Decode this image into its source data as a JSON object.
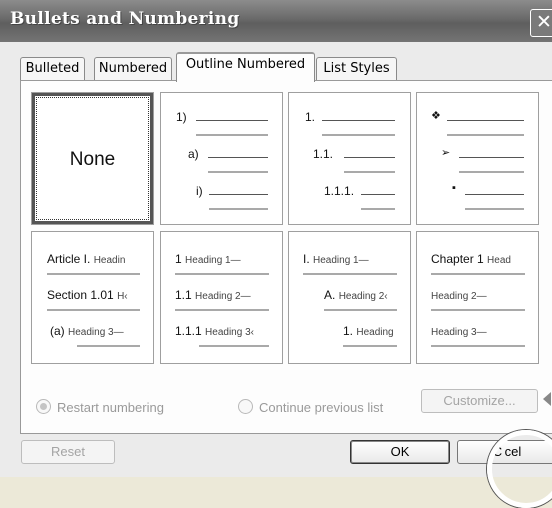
{
  "dialog": {
    "title": "Bullets and Numbering",
    "close_glyph": "✕"
  },
  "tabs": [
    {
      "label": "Bulleted"
    },
    {
      "label": "Numbered"
    },
    {
      "label": "Outline Numbered"
    },
    {
      "label": "List Styles"
    }
  ],
  "active_tab": "Outline Numbered",
  "gallery": {
    "none": "None",
    "numeric": [
      "1)",
      "a)",
      "i)"
    ],
    "decimal": [
      "1.",
      "1.1.",
      "1.1.1."
    ],
    "bullets": [
      "❖",
      "➢",
      "▪"
    ],
    "article": [
      {
        "prefix": "Article I.",
        "text": "Headin"
      },
      {
        "prefix": "Section 1.01",
        "text": "H‹"
      },
      {
        "prefix": "(a)",
        "text": "Heading 3—"
      }
    ],
    "legal": [
      {
        "prefix": "1",
        "text": "Heading 1—"
      },
      {
        "prefix": "1.1",
        "text": "Heading 2—"
      },
      {
        "prefix": "1.1.1",
        "text": "Heading 3‹"
      }
    ],
    "roman": [
      {
        "prefix": "I.",
        "text": "Heading 1—"
      },
      {
        "prefix": "A.",
        "text": "Heading 2‹"
      },
      {
        "prefix": "1.",
        "text": "Heading"
      }
    ],
    "chapter": [
      {
        "prefix": "Chapter 1",
        "text": "Head"
      },
      {
        "prefix": "",
        "text": "Heading 2—"
      },
      {
        "prefix": "",
        "text": "Heading 3—"
      }
    ]
  },
  "options": {
    "restart": "Restart numbering",
    "continue": "Continue previous list",
    "selected": "restart"
  },
  "buttons": {
    "customize": "Customize...",
    "reset": "Reset",
    "ok": "OK",
    "cancel": "C cel"
  }
}
